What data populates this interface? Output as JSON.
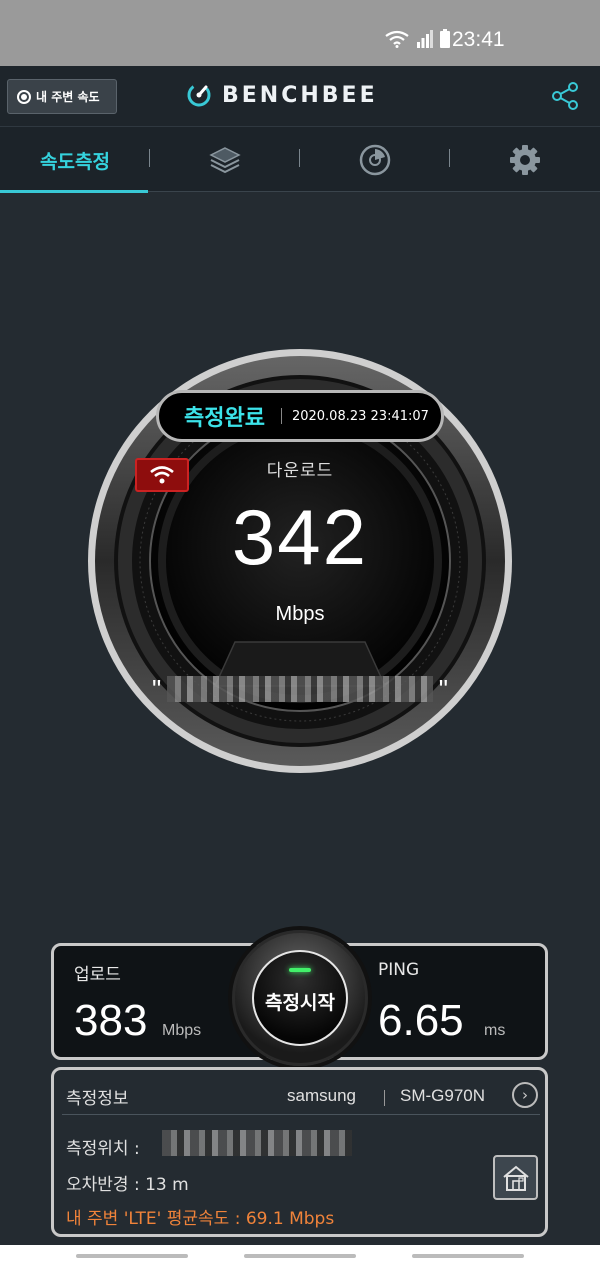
{
  "status_bar": {
    "time": "23:41"
  },
  "header": {
    "nearby_button": "내 주변 속도",
    "brand": "BENCHBEE"
  },
  "tabs": [
    {
      "label": "속도측정",
      "icon": "speed-test",
      "active": true
    },
    {
      "label": "",
      "icon": "layers-icon"
    },
    {
      "label": "",
      "icon": "history-chart-icon"
    },
    {
      "label": "",
      "icon": "gear-icon"
    }
  ],
  "gauge": {
    "status": "측정완료",
    "datetime": "2020.08.23 23:41:07",
    "metric_label": "다운로드",
    "value": "342",
    "unit": "Mbps",
    "ssid_open": "\"",
    "ssid_close": "\""
  },
  "results": {
    "upload_label": "업로드",
    "upload_value": "383",
    "upload_unit": "Mbps",
    "start_label": "측정시작",
    "ping_label": "PING",
    "ping_value": "6.65",
    "ping_unit": "ms"
  },
  "info": {
    "title": "측정정보",
    "brand": "samsung",
    "model": "SM-G970N",
    "location_label": "측정위치 :",
    "error_radius": "오차반경 : 13 m",
    "average": "내 주변 'LTE' 평균속도 :  69.1 Mbps"
  },
  "colors": {
    "accent": "#39c9d6",
    "done_text": "#3ce3ea",
    "average_text": "#f0833a",
    "wifi_badge": "#8e0d0d"
  }
}
